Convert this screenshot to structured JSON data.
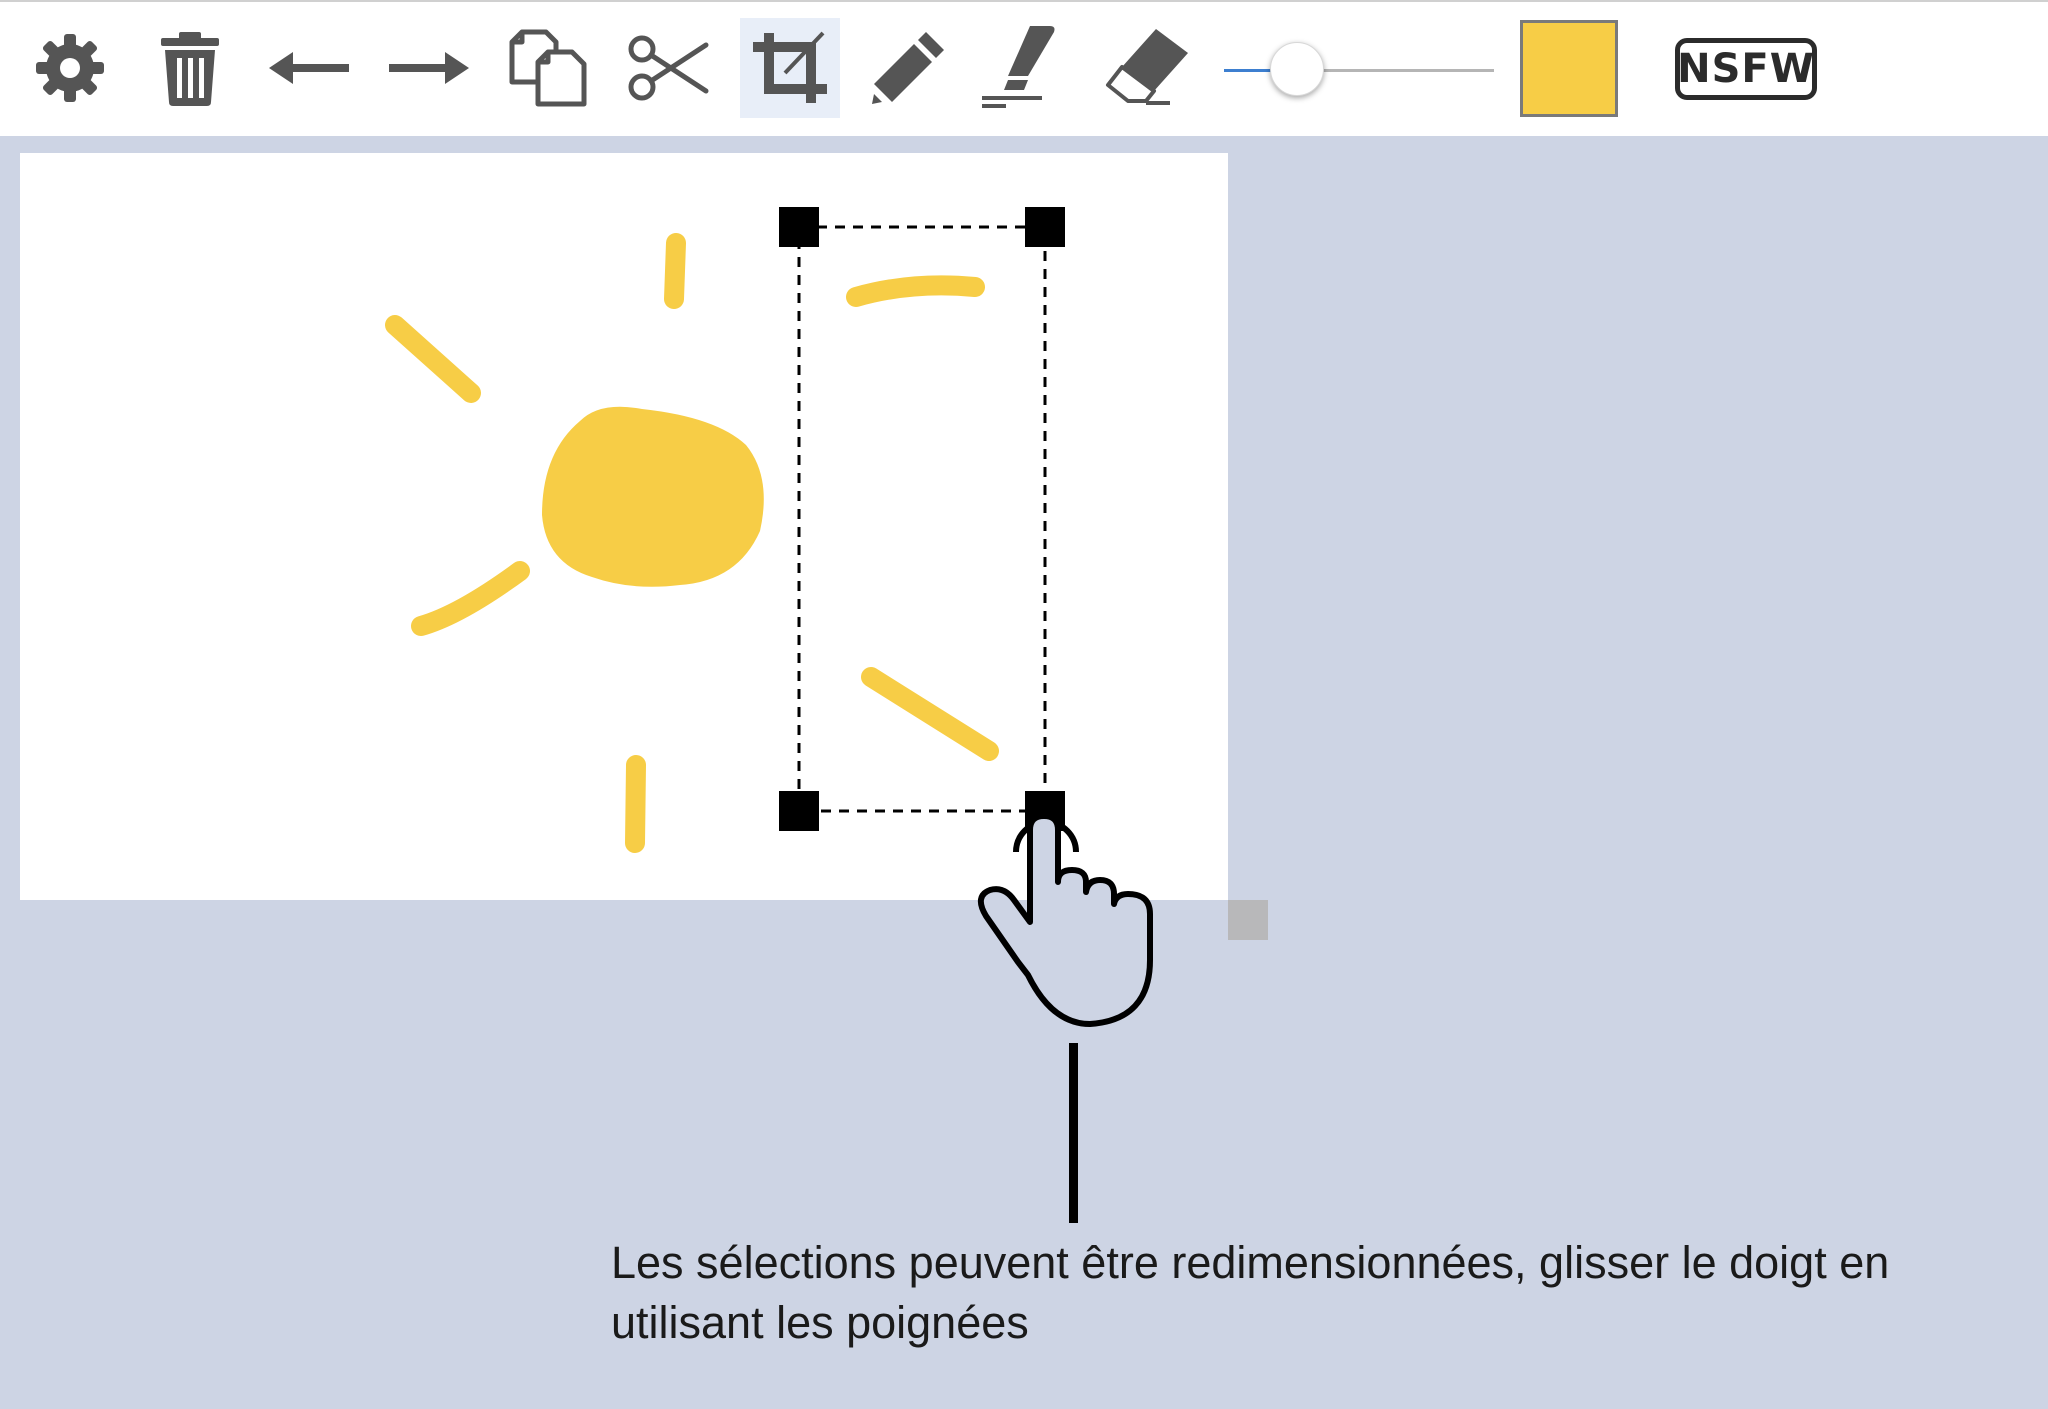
{
  "toolbar": {
    "tools": [
      {
        "name": "settings",
        "icon": "gear-icon"
      },
      {
        "name": "delete",
        "icon": "trash-icon"
      },
      {
        "name": "undo",
        "icon": "arrow-left-icon"
      },
      {
        "name": "redo",
        "icon": "arrow-right-icon"
      },
      {
        "name": "copy",
        "icon": "copy-icon"
      },
      {
        "name": "cut",
        "icon": "scissors-icon"
      },
      {
        "name": "crop-select",
        "icon": "crop-icon",
        "active": true
      },
      {
        "name": "pencil",
        "icon": "pencil-icon"
      },
      {
        "name": "highlighter",
        "icon": "highlighter-icon"
      },
      {
        "name": "eraser",
        "icon": "eraser-icon"
      }
    ],
    "brush_size_level": 0.28,
    "current_color": "#f7cd46",
    "nsfw_label": "NSFW"
  },
  "colors": {
    "icon": "#555555",
    "active_tool_bg": "#e8eef8",
    "slider_filled": "#3d7fd0",
    "slider_empty": "#b5b5b5",
    "sun": "#f7cd46",
    "workspace": "#cdd4e4",
    "selection": "#000000"
  },
  "instruction": "Les sélections peuvent être redimensionnées, glisser le doigt en utilisant les poignées"
}
